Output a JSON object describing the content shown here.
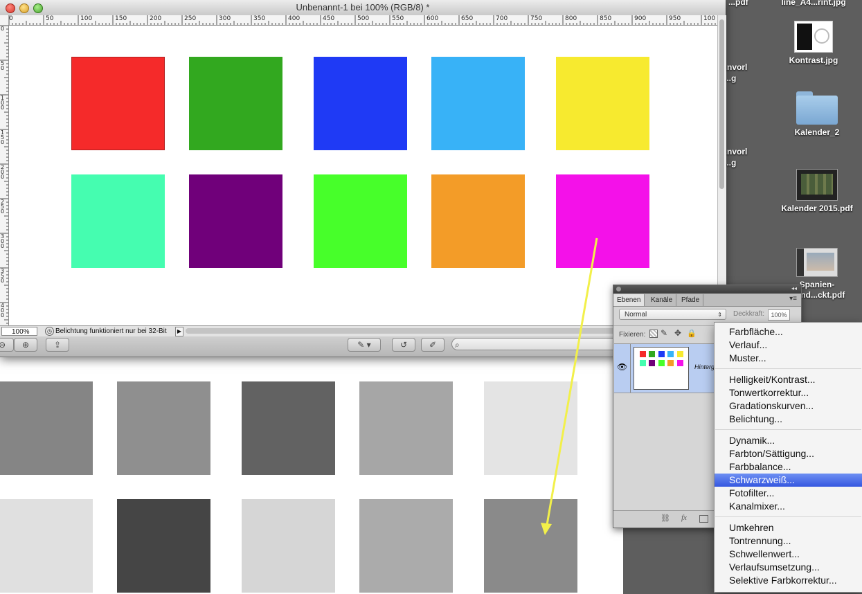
{
  "desktop": {
    "icons": [
      {
        "label": "line_A4...rint.jpg",
        "icon": "jpg-file-icon"
      },
      {
        "label": "Kontrast.jpg",
        "icon": "jpg-file-icon"
      },
      {
        "label": "Kalender_2",
        "icon": "folder-icon"
      },
      {
        "label": "Kalender 2015.pdf",
        "icon": "pdf-file-icon"
      },
      {
        "label": "Spanien-\n...end...ckt.pdf",
        "icon": "pdf-file-icon"
      }
    ],
    "partial_labels": [
      "...pdf",
      "...nvorl",
      "...g",
      "...nvorl",
      "...g"
    ]
  },
  "window": {
    "title": "Unbenannt-1 bei 100% (RGB/8) *",
    "ruler_top": [
      "0",
      "50",
      "100",
      "150",
      "200",
      "250",
      "300",
      "350",
      "400",
      "450",
      "500",
      "550",
      "600",
      "650",
      "700",
      "750",
      "800",
      "850",
      "900",
      "950",
      "100"
    ],
    "ruler_left": [
      "0",
      "5 0",
      "1 0 0",
      "1 5 0",
      "2 0 0",
      "2 5 0",
      "3 0 0",
      "3 5 0",
      "4 0 0"
    ],
    "status": {
      "zoom": "100%",
      "message": "Belichtung funktioniert nur bei 32-Bit"
    }
  },
  "canvas": {
    "squares": [
      {
        "color": "#f52a2a"
      },
      {
        "color": "#32a81f"
      },
      {
        "color": "#1f3af5"
      },
      {
        "color": "#38b2f7"
      },
      {
        "color": "#f7ea2f"
      },
      {
        "color": "#45fdb0"
      },
      {
        "color": "#70007a"
      },
      {
        "color": "#47ff2a"
      },
      {
        "color": "#f39c28"
      },
      {
        "color": "#f411e9"
      }
    ]
  },
  "preview": {
    "squares": [
      {
        "color": "#858585"
      },
      {
        "color": "#8f8f8f"
      },
      {
        "color": "#626262"
      },
      {
        "color": "#a6a6a6"
      },
      {
        "color": "#e4e4e4"
      },
      {
        "color": "#e0e0e0"
      },
      {
        "color": "#454545"
      },
      {
        "color": "#d6d6d6"
      },
      {
        "color": "#ababab"
      },
      {
        "color": "#8a8a8a"
      }
    ]
  },
  "layers_panel": {
    "tabs": [
      "Ebenen",
      "Kanäle",
      "Pfade"
    ],
    "blend_mode": "Normal",
    "opacity_label": "Deckkraft:",
    "opacity_value": "100%",
    "fix_label": "Fixieren:",
    "layer_name": "Hintergr"
  },
  "menu": {
    "groups": [
      [
        "Farbfläche...",
        "Verlauf...",
        "Muster..."
      ],
      [
        "Helligkeit/Kontrast...",
        "Tonwertkorrektur...",
        "Gradationskurven...",
        "Belichtung..."
      ],
      [
        "Dynamik...",
        "Farbton/Sättigung...",
        "Farbbalance...",
        "Schwarzweiß...",
        "Fotofilter...",
        "Kanalmixer..."
      ],
      [
        "Umkehren",
        "Tontrennung...",
        "Schwellenwert...",
        "Verlaufsumsetzung...",
        "Selektive Farbkorrektur..."
      ]
    ],
    "selected": "Schwarzweiß..."
  },
  "annotation": {
    "arrow_color": "#f2f04a"
  }
}
